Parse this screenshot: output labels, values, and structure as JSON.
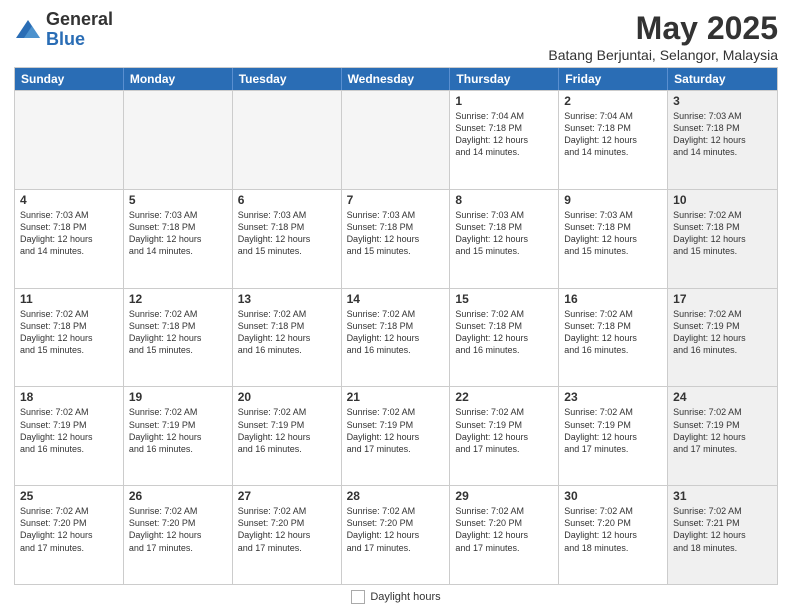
{
  "logo": {
    "general": "General",
    "blue": "Blue"
  },
  "title": "May 2025",
  "subtitle": "Batang Berjuntai, Selangor, Malaysia",
  "days_of_week": [
    "Sunday",
    "Monday",
    "Tuesday",
    "Wednesday",
    "Thursday",
    "Friday",
    "Saturday"
  ],
  "weeks": [
    [
      {
        "day": "",
        "info": "",
        "empty": true
      },
      {
        "day": "",
        "info": "",
        "empty": true
      },
      {
        "day": "",
        "info": "",
        "empty": true
      },
      {
        "day": "",
        "info": "",
        "empty": true
      },
      {
        "day": "1",
        "info": "Sunrise: 7:04 AM\nSunset: 7:18 PM\nDaylight: 12 hours\nand 14 minutes."
      },
      {
        "day": "2",
        "info": "Sunrise: 7:04 AM\nSunset: 7:18 PM\nDaylight: 12 hours\nand 14 minutes."
      },
      {
        "day": "3",
        "info": "Sunrise: 7:03 AM\nSunset: 7:18 PM\nDaylight: 12 hours\nand 14 minutes.",
        "shaded": true
      }
    ],
    [
      {
        "day": "4",
        "info": "Sunrise: 7:03 AM\nSunset: 7:18 PM\nDaylight: 12 hours\nand 14 minutes."
      },
      {
        "day": "5",
        "info": "Sunrise: 7:03 AM\nSunset: 7:18 PM\nDaylight: 12 hours\nand 14 minutes."
      },
      {
        "day": "6",
        "info": "Sunrise: 7:03 AM\nSunset: 7:18 PM\nDaylight: 12 hours\nand 15 minutes."
      },
      {
        "day": "7",
        "info": "Sunrise: 7:03 AM\nSunset: 7:18 PM\nDaylight: 12 hours\nand 15 minutes."
      },
      {
        "day": "8",
        "info": "Sunrise: 7:03 AM\nSunset: 7:18 PM\nDaylight: 12 hours\nand 15 minutes."
      },
      {
        "day": "9",
        "info": "Sunrise: 7:03 AM\nSunset: 7:18 PM\nDaylight: 12 hours\nand 15 minutes."
      },
      {
        "day": "10",
        "info": "Sunrise: 7:02 AM\nSunset: 7:18 PM\nDaylight: 12 hours\nand 15 minutes.",
        "shaded": true
      }
    ],
    [
      {
        "day": "11",
        "info": "Sunrise: 7:02 AM\nSunset: 7:18 PM\nDaylight: 12 hours\nand 15 minutes."
      },
      {
        "day": "12",
        "info": "Sunrise: 7:02 AM\nSunset: 7:18 PM\nDaylight: 12 hours\nand 15 minutes."
      },
      {
        "day": "13",
        "info": "Sunrise: 7:02 AM\nSunset: 7:18 PM\nDaylight: 12 hours\nand 16 minutes."
      },
      {
        "day": "14",
        "info": "Sunrise: 7:02 AM\nSunset: 7:18 PM\nDaylight: 12 hours\nand 16 minutes."
      },
      {
        "day": "15",
        "info": "Sunrise: 7:02 AM\nSunset: 7:18 PM\nDaylight: 12 hours\nand 16 minutes."
      },
      {
        "day": "16",
        "info": "Sunrise: 7:02 AM\nSunset: 7:18 PM\nDaylight: 12 hours\nand 16 minutes."
      },
      {
        "day": "17",
        "info": "Sunrise: 7:02 AM\nSunset: 7:19 PM\nDaylight: 12 hours\nand 16 minutes.",
        "shaded": true
      }
    ],
    [
      {
        "day": "18",
        "info": "Sunrise: 7:02 AM\nSunset: 7:19 PM\nDaylight: 12 hours\nand 16 minutes."
      },
      {
        "day": "19",
        "info": "Sunrise: 7:02 AM\nSunset: 7:19 PM\nDaylight: 12 hours\nand 16 minutes."
      },
      {
        "day": "20",
        "info": "Sunrise: 7:02 AM\nSunset: 7:19 PM\nDaylight: 12 hours\nand 16 minutes."
      },
      {
        "day": "21",
        "info": "Sunrise: 7:02 AM\nSunset: 7:19 PM\nDaylight: 12 hours\nand 17 minutes."
      },
      {
        "day": "22",
        "info": "Sunrise: 7:02 AM\nSunset: 7:19 PM\nDaylight: 12 hours\nand 17 minutes."
      },
      {
        "day": "23",
        "info": "Sunrise: 7:02 AM\nSunset: 7:19 PM\nDaylight: 12 hours\nand 17 minutes."
      },
      {
        "day": "24",
        "info": "Sunrise: 7:02 AM\nSunset: 7:19 PM\nDaylight: 12 hours\nand 17 minutes.",
        "shaded": true
      }
    ],
    [
      {
        "day": "25",
        "info": "Sunrise: 7:02 AM\nSunset: 7:20 PM\nDaylight: 12 hours\nand 17 minutes."
      },
      {
        "day": "26",
        "info": "Sunrise: 7:02 AM\nSunset: 7:20 PM\nDaylight: 12 hours\nand 17 minutes."
      },
      {
        "day": "27",
        "info": "Sunrise: 7:02 AM\nSunset: 7:20 PM\nDaylight: 12 hours\nand 17 minutes."
      },
      {
        "day": "28",
        "info": "Sunrise: 7:02 AM\nSunset: 7:20 PM\nDaylight: 12 hours\nand 17 minutes."
      },
      {
        "day": "29",
        "info": "Sunrise: 7:02 AM\nSunset: 7:20 PM\nDaylight: 12 hours\nand 17 minutes."
      },
      {
        "day": "30",
        "info": "Sunrise: 7:02 AM\nSunset: 7:20 PM\nDaylight: 12 hours\nand 18 minutes."
      },
      {
        "day": "31",
        "info": "Sunrise: 7:02 AM\nSunset: 7:21 PM\nDaylight: 12 hours\nand 18 minutes.",
        "shaded": true
      }
    ]
  ],
  "footer": {
    "daylight_label": "Daylight hours"
  },
  "colors": {
    "header_bg": "#2a6db5",
    "shaded_bg": "#f0f0f0",
    "empty_bg": "#f5f5f5"
  }
}
